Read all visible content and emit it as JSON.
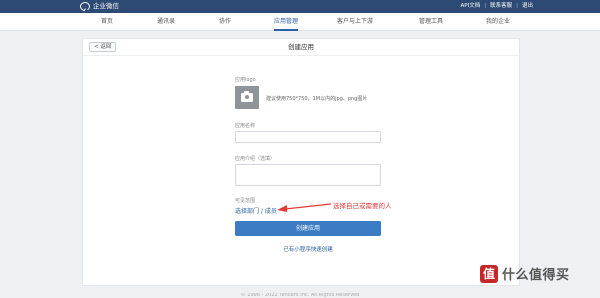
{
  "topbar": {
    "app_title": "企业微信",
    "links": [
      "API文档",
      "联系客服",
      "退出"
    ]
  },
  "nav": {
    "items": [
      "首页",
      "通讯录",
      "协作",
      "应用管理",
      "客户与上下游",
      "管理工具",
      "我的企业"
    ],
    "active_index": 3
  },
  "card": {
    "back_label": "< 返回",
    "title": "创建应用"
  },
  "form": {
    "logo_label": "应用logo",
    "logo_hint": "建议使用750*750，1M以内的jpg、png图片",
    "name_label": "应用名称",
    "name_value": "",
    "intro_label": "应用介绍（选填）",
    "intro_value": "",
    "visible_label": "可见范围",
    "select_members_link": "选择部门 / 成员",
    "create_button": "创建应用",
    "miniprogram_link": "已有小程序快速创建"
  },
  "annotation": {
    "text": "选择自己或需要的人",
    "color": "#e53935"
  },
  "footer": {
    "text": "© 1998 - 2022 Tencent Inc. All Rights Reserved"
  },
  "watermark": {
    "badge": "值",
    "text": "什么值得买"
  },
  "colors": {
    "topbar": "#2c4a73",
    "accent": "#2c5fa7",
    "button": "#3b7cc4"
  }
}
